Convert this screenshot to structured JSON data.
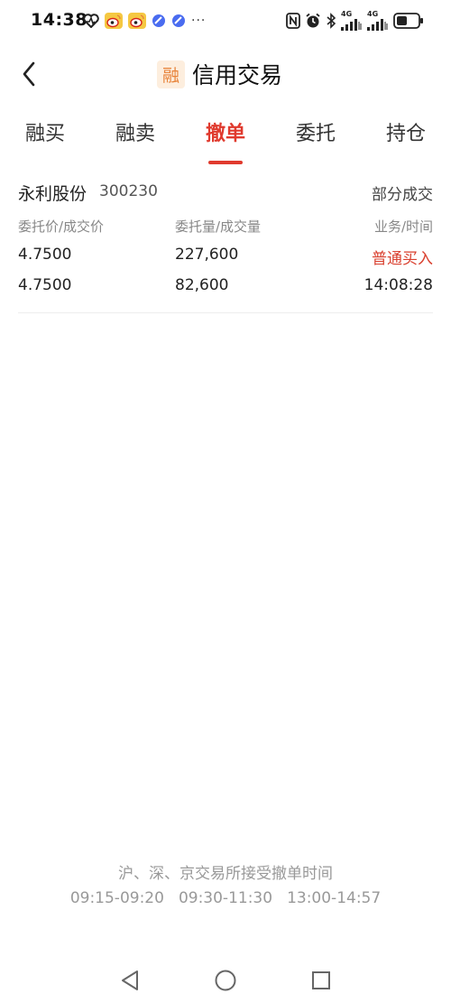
{
  "status_bar": {
    "time": "14:38",
    "dots": "···",
    "network_1": "4G",
    "network_2": "4G"
  },
  "header": {
    "badge": "融",
    "title": "信用交易",
    "accent_color": "#e03a2e",
    "badge_color": "#e8833a"
  },
  "tabs": [
    {
      "label": "融买",
      "active": false
    },
    {
      "label": "融卖",
      "active": false
    },
    {
      "label": "撤单",
      "active": true
    },
    {
      "label": "委托",
      "active": false
    },
    {
      "label": "持仓",
      "active": false
    }
  ],
  "order": {
    "stock_name": "永利股份",
    "stock_code": "300230",
    "status": "部分成交",
    "columns": [
      "委托价/成交价",
      "委托量/成交量",
      "业务/时间"
    ],
    "rows": [
      [
        "4.7500",
        "227,600",
        "普通买入"
      ],
      [
        "4.7500",
        "82,600",
        "14:08:28"
      ]
    ]
  },
  "footer": {
    "note": "沪、深、京交易所接受撤单时间",
    "time_slots": [
      "09:15-09:20",
      "09:30-11:30",
      "13:00-14:57"
    ]
  }
}
